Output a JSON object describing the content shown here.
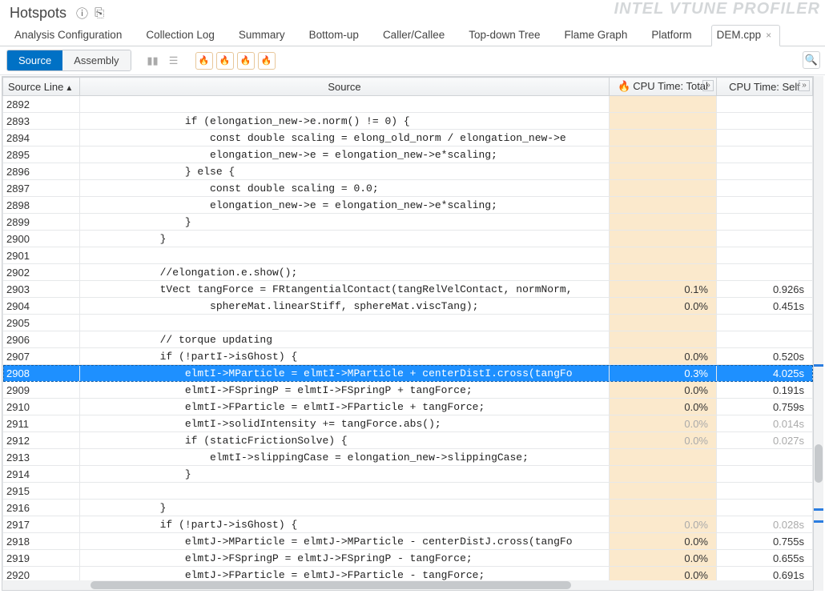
{
  "title": "Hotspots",
  "brand": "INTEL VTUNE PROFILER",
  "tabs": [
    {
      "label": "Analysis Configuration"
    },
    {
      "label": "Collection Log"
    },
    {
      "label": "Summary"
    },
    {
      "label": "Bottom-up"
    },
    {
      "label": "Caller/Callee"
    },
    {
      "label": "Top-down Tree"
    },
    {
      "label": "Flame Graph"
    },
    {
      "label": "Platform"
    },
    {
      "label": "DEM.cpp",
      "active": true,
      "closable": true
    }
  ],
  "view_toggle": {
    "source": "Source",
    "assembly": "Assembly"
  },
  "columns": {
    "line": "Source Line",
    "source": "Source",
    "total": "CPU Time: Total",
    "self": "CPU Time: Self"
  },
  "rows": [
    {
      "line": "2892",
      "src": "",
      "total": "",
      "self": ""
    },
    {
      "line": "2893",
      "src": "                if (elongation_new->e.norm() != 0) {",
      "total": "",
      "self": ""
    },
    {
      "line": "2894",
      "src": "                    const double scaling = elong_old_norm / elongation_new->e",
      "total": "",
      "self": ""
    },
    {
      "line": "2895",
      "src": "                    elongation_new->e = elongation_new->e*scaling;",
      "total": "",
      "self": ""
    },
    {
      "line": "2896",
      "src": "                } else {",
      "total": "",
      "self": ""
    },
    {
      "line": "2897",
      "src": "                    const double scaling = 0.0;",
      "total": "",
      "self": ""
    },
    {
      "line": "2898",
      "src": "                    elongation_new->e = elongation_new->e*scaling;",
      "total": "",
      "self": ""
    },
    {
      "line": "2899",
      "src": "                }",
      "total": "",
      "self": ""
    },
    {
      "line": "2900",
      "src": "            }",
      "total": "",
      "self": ""
    },
    {
      "line": "2901",
      "src": "",
      "total": "",
      "self": ""
    },
    {
      "line": "2902",
      "src": "            //elongation.e.show();",
      "total": "",
      "self": ""
    },
    {
      "line": "2903",
      "src": "            tVect tangForce = FRtangentialContact(tangRelVelContact, normNorm,",
      "total": "0.1%",
      "self": "0.926s"
    },
    {
      "line": "2904",
      "src": "                    sphereMat.linearStiff, sphereMat.viscTang);",
      "total": "0.0%",
      "self": "0.451s"
    },
    {
      "line": "2905",
      "src": "",
      "total": "",
      "self": ""
    },
    {
      "line": "2906",
      "src": "            // torque updating",
      "total": "",
      "self": ""
    },
    {
      "line": "2907",
      "src": "            if (!partI->isGhost) {",
      "total": "0.0%",
      "self": "0.520s"
    },
    {
      "line": "2908",
      "src": "                elmtI->MParticle = elmtI->MParticle + centerDistI.cross(tangFo",
      "total": "0.3%",
      "self": "4.025s",
      "selected": true
    },
    {
      "line": "2909",
      "src": "                elmtI->FSpringP = elmtI->FSpringP + tangForce;",
      "total": "0.0%",
      "self": "0.191s"
    },
    {
      "line": "2910",
      "src": "                elmtI->FParticle = elmtI->FParticle + tangForce;",
      "total": "0.0%",
      "self": "0.759s"
    },
    {
      "line": "2911",
      "src": "                elmtI->solidIntensity += tangForce.abs();",
      "total": "0.0%",
      "self": "0.014s",
      "dim": true
    },
    {
      "line": "2912",
      "src": "                if (staticFrictionSolve) {",
      "total": "0.0%",
      "self": "0.027s",
      "dim": true
    },
    {
      "line": "2913",
      "src": "                    elmtI->slippingCase = elongation_new->slippingCase;",
      "total": "",
      "self": ""
    },
    {
      "line": "2914",
      "src": "                }",
      "total": "",
      "self": ""
    },
    {
      "line": "2915",
      "src": "",
      "total": "",
      "self": ""
    },
    {
      "line": "2916",
      "src": "            }",
      "total": "",
      "self": ""
    },
    {
      "line": "2917",
      "src": "            if (!partJ->isGhost) {",
      "total": "0.0%",
      "self": "0.028s",
      "dim": true
    },
    {
      "line": "2918",
      "src": "                elmtJ->MParticle = elmtJ->MParticle - centerDistJ.cross(tangFo",
      "total": "0.0%",
      "self": "0.755s"
    },
    {
      "line": "2919",
      "src": "                elmtJ->FSpringP = elmtJ->FSpringP - tangForce;",
      "total": "0.0%",
      "self": "0.655s"
    },
    {
      "line": "2920",
      "src": "                elmtJ->FParticle = elmtJ->FParticle - tangForce;",
      "total": "0.0%",
      "self": "0.691s"
    }
  ]
}
